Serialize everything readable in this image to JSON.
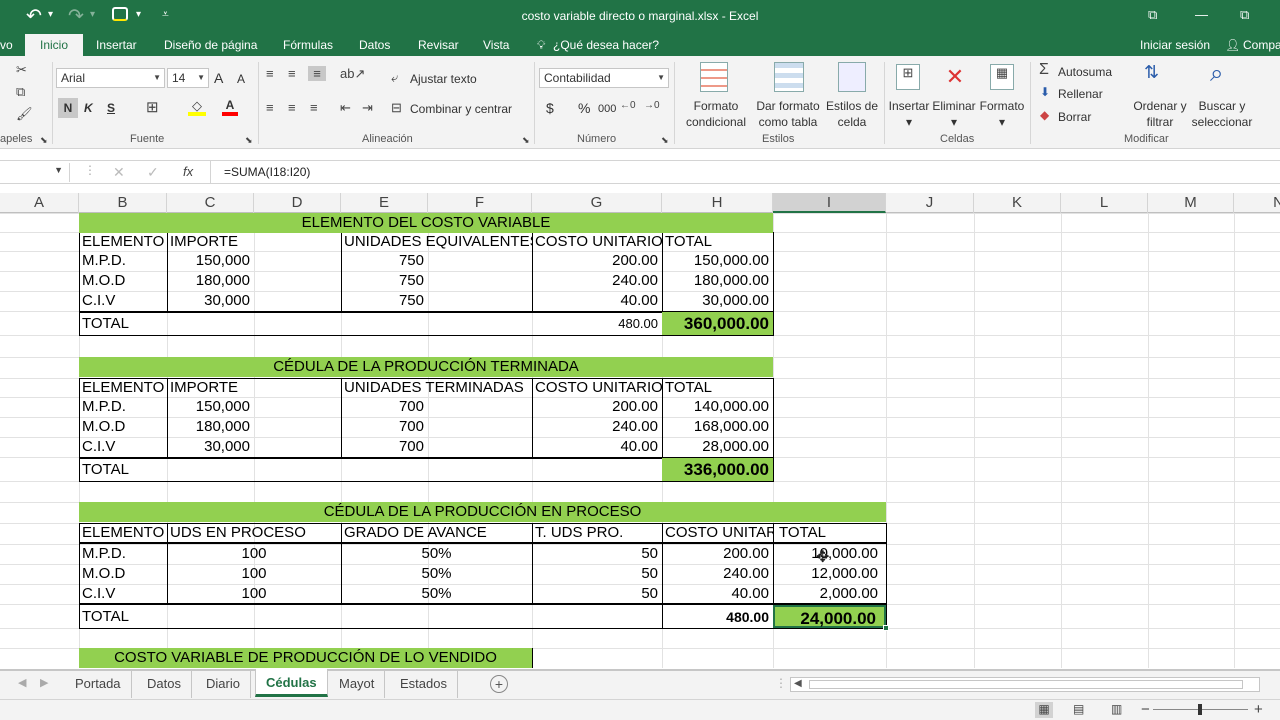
{
  "window": {
    "title": "costo variable directo o marginal.xlsx - Excel",
    "restore_glyph": "⧉",
    "min_glyph": "—"
  },
  "quick_access": {
    "undo": "↶",
    "redo": "↷",
    "dropdown": "▾",
    "paint": "🖌",
    "more": "⩡"
  },
  "ribbon_tabs": [
    "vo",
    "Inicio",
    "Insertar",
    "Diseño de página",
    "Fórmulas",
    "Datos",
    "Revisar",
    "Vista"
  ],
  "tell_me": "¿Qué desea hacer?",
  "signin": "Iniciar sesión",
  "share": "Compa",
  "ribbon": {
    "clipboard": {
      "label": "apeles"
    },
    "font": {
      "label": "Fuente",
      "name": "Arial",
      "size": "14",
      "bold": "N",
      "italic": "K",
      "underline": "S",
      "grow": "A",
      "shrink": "A"
    },
    "alignment": {
      "label": "Alineación",
      "wrap": "Ajustar texto",
      "merge": "Combinar y centrar"
    },
    "number": {
      "label": "Número",
      "format": "Contabilidad",
      "currency": "$",
      "percent": "%",
      "thousands": "000"
    },
    "styles": {
      "label": "Estilos",
      "cond_format": [
        "Formato",
        "condicional"
      ],
      "table_format": [
        "Dar formato",
        "como tabla"
      ],
      "cell_styles": [
        "Estilos de",
        "celda"
      ]
    },
    "cells": {
      "label": "Celdas",
      "insert": "Insertar",
      "delete": "Eliminar",
      "format": "Formato"
    },
    "editing": {
      "label": "Modificar",
      "autosum": "Autosuma",
      "fill": "Rellenar",
      "clear": "Borrar",
      "sort": [
        "Ordenar y",
        "filtrar"
      ],
      "find": [
        "Buscar y",
        "seleccionar"
      ]
    }
  },
  "formula_bar": {
    "name_box": "",
    "cancel": "✕",
    "enter": "✓",
    "fx": "fx",
    "formula": "=SUMA(I18:I20)"
  },
  "columns": [
    "A",
    "B",
    "C",
    "D",
    "E",
    "F",
    "G",
    "H",
    "I",
    "J",
    "K",
    "L",
    "M",
    "N"
  ],
  "table1": {
    "title": "ELEMENTO DEL COSTO VARIABLE",
    "headers": [
      "ELEMENTO",
      "IMPORTE",
      "UNIDADES EQUIVALENTES",
      "COSTO UNITARIO",
      "TOTAL"
    ],
    "rows": [
      [
        "M.P.D.",
        "150,000",
        "750",
        "200.00",
        "150,000.00"
      ],
      [
        "M.O.D",
        "180,000",
        "750",
        "240.00",
        "180,000.00"
      ],
      [
        "C.I.V",
        "30,000",
        "750",
        "40.00",
        "30,000.00"
      ]
    ],
    "total_label": "TOTAL",
    "total_unit": "480.00",
    "total_value": "360,000.00"
  },
  "table2": {
    "title": "CÉDULA DE LA PRODUCCIÓN TERMINADA",
    "headers": [
      "ELEMENTO",
      "IMPORTE",
      "UNIDADES TERMINADAS",
      "COSTO UNITARIO",
      "TOTAL"
    ],
    "rows": [
      [
        "M.P.D.",
        "150,000",
        "700",
        "200.00",
        "140,000.00"
      ],
      [
        "M.O.D",
        "180,000",
        "700",
        "240.00",
        "168,000.00"
      ],
      [
        "C.I.V",
        "30,000",
        "700",
        "40.00",
        "28,000.00"
      ]
    ],
    "total_label": "TOTAL",
    "total_value": "336,000.00"
  },
  "table3": {
    "title": "CÉDULA DE LA PRODUCCIÓN EN PROCESO",
    "headers": [
      "ELEMENTO",
      "UDS EN PROCESO",
      "GRADO DE AVANCE",
      "T. UDS PRO.",
      "COSTO UNITAR",
      "TOTAL"
    ],
    "rows": [
      [
        "M.P.D.",
        "100",
        "50%",
        "50",
        "200.00",
        "10,000.00"
      ],
      [
        "M.O.D",
        "100",
        "50%",
        "50",
        "240.00",
        "12,000.00"
      ],
      [
        "C.I.V",
        "100",
        "50%",
        "50",
        "40.00",
        "2,000.00"
      ]
    ],
    "total_label": "TOTAL",
    "total_unit": "480.00",
    "total_value": "24,000.00"
  },
  "table4": {
    "title": "COSTO VARIABLE DE PRODUCCIÓN DE LO VENDIDO"
  },
  "sheets": [
    "Portada",
    "Datos",
    "Diario",
    "Cédulas",
    "Mayot",
    "Estados"
  ],
  "active_sheet": "Cédulas",
  "status": {
    "zoom_minus": "−",
    "zoom_plus": "+"
  }
}
